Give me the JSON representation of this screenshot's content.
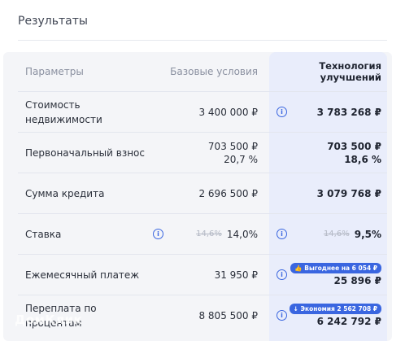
{
  "title": "Результаты",
  "table": {
    "columns": {
      "params": "Параметры",
      "base": "Базовые условия",
      "improved": "Технология улучшений"
    },
    "rows": [
      {
        "label": "Стоимость недвижимости",
        "base": "3 400 000 ₽",
        "improved": "3 783 268 ₽"
      },
      {
        "label": "Первоначальный взнос",
        "base": "703 500 ₽",
        "base_pct": "20,7 %",
        "improved": "703 500 ₽",
        "improved_pct": "18,6 %"
      },
      {
        "label": "Сумма кредита",
        "base": "2 696 500 ₽",
        "improved": "3 079 768 ₽"
      },
      {
        "label": "Ставка",
        "base_old": "14,6%",
        "base": "14,0%",
        "improved_old": "14,6%",
        "improved": "9,5%"
      },
      {
        "label": "Ежемесячный платеж",
        "base": "31 950 ₽",
        "badge": "Выгоднее на 6 054 ₽",
        "improved": "25 896 ₽"
      },
      {
        "label": "Переплата по процентам",
        "base": "8 805 500 ₽",
        "badge": "Экономия 2 562 708 ₽",
        "improved": "6 242 792 ₽"
      }
    ]
  },
  "watermark": "ДомКлик"
}
